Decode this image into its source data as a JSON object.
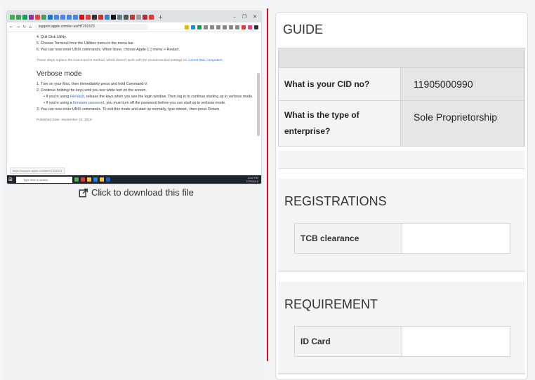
{
  "left": {
    "thumbnail": {
      "url": "support.apple.com/en-us/HT201573",
      "doc_lines_top": [
        "4. Quit Disk Utility.",
        "5. Choose Terminal from the Utilities menu in the menu bar.",
        "6. You can now enter UNIX commands. When done, choose Apple () menu > Restart."
      ],
      "note_text": "These steps replace the Command-S method, which doesn't work with the recommended settings on",
      "note_link": "current Mac computers.",
      "heading": "Verbose mode",
      "steps": [
        "1. Turn on your Mac, then immediately press and hold Command-V.",
        "2. Continue holding the keys until you see white text on the screen."
      ],
      "bullet1_pre": "• If you're using",
      "bullet1_link": "FileVault",
      "bullet1_post": ", release the keys when you see the login window. Then log in to continue starting up in verbose mode.",
      "bullet2_pre": "• If you're using a",
      "bullet2_link": "firmware password",
      "bullet2_post": ", you must turn off the password before you can start up in verbose mode.",
      "step3": "3. You can now enter UNIX commands. To exit this mode and start up normally, type reboot , then press Return.",
      "published": "Published Date: September 24, 2018",
      "hover_url": "https://support.apple.com/kb/HT201573",
      "taskbar_search": "Type here to search",
      "tray_time": "5:52 PM",
      "tray_date": "7/29/2019"
    },
    "download_label": "Click to download this file"
  },
  "guide": {
    "title": "GUIDE",
    "rows": [
      {
        "question": "What is your CID no?",
        "answer": "11905000990"
      },
      {
        "question": "What is the type of enterprise?",
        "answer": "Sole Proprietorship"
      }
    ]
  },
  "registrations": {
    "title": "REGISTRATIONS",
    "items": [
      {
        "label": "TCB clearance",
        "value": ""
      }
    ]
  },
  "requirement": {
    "title": "REQUIREMENT",
    "items": [
      {
        "label": "ID Card",
        "value": ""
      }
    ]
  },
  "colors": {
    "divider": "#d8101a",
    "link": "#2f6fd6"
  }
}
